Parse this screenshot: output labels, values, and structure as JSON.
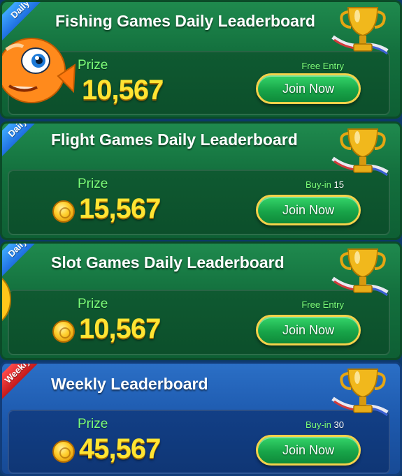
{
  "cards": [
    {
      "title": "Fishing Games Daily Leaderboard",
      "tag": "Daily",
      "prize_label": "Prize",
      "prize_value": "10,567",
      "entry_label": "Free Entry",
      "entry_value": "",
      "join_label": "Join Now",
      "theme": "green"
    },
    {
      "title": "Flight Games Daily Leaderboard",
      "tag": "Daily",
      "prize_label": "Prize",
      "prize_value": "15,567",
      "entry_label": "Buy-in",
      "entry_value": "15",
      "join_label": "Join Now",
      "theme": "green"
    },
    {
      "title": "Slot Games Daily Leaderboard",
      "tag": "Daily",
      "prize_label": "Prize",
      "prize_value": "10,567",
      "entry_label": "Free Entry",
      "entry_value": "",
      "join_label": "Join Now",
      "theme": "green"
    },
    {
      "title": "Weekly Leaderboard",
      "tag": "Weekly",
      "prize_label": "Prize",
      "prize_value": "45,567",
      "entry_label": "Buy-in",
      "entry_value": "30",
      "join_label": "Join Now",
      "theme": "blue"
    }
  ],
  "icons": {
    "trophy": "trophy-icon",
    "coin": "coin-icon",
    "fish": "fish-mascot-icon"
  },
  "colors": {
    "green_card": "#136f3d",
    "blue_card": "#1d59ad",
    "prize_label": "#7dff7a",
    "prize_value": "#ffe433",
    "join_button": "#18a549",
    "join_border": "#f4d24a"
  }
}
